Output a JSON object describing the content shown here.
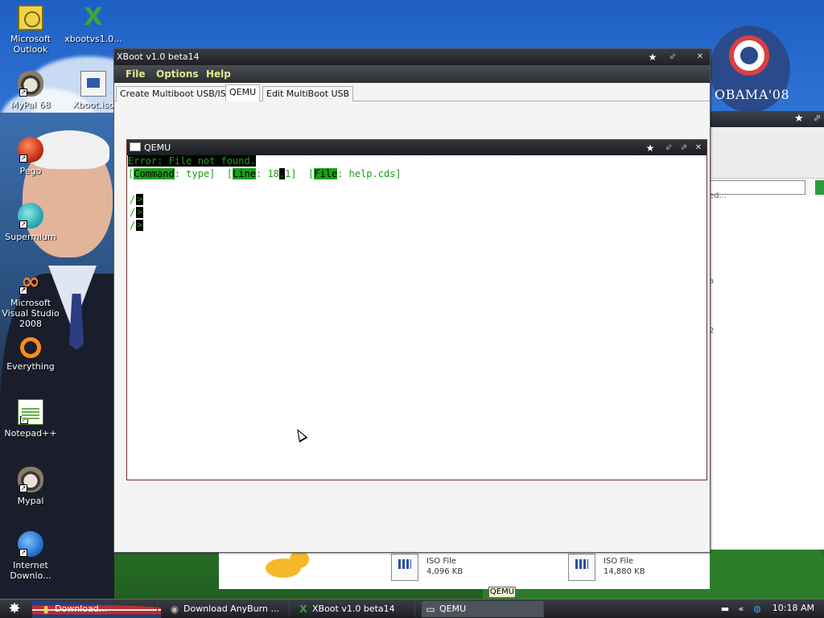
{
  "desktop": {
    "icons": [
      {
        "label": "Microsoft Outlook",
        "icon": "outlook-icon"
      },
      {
        "label": "xbootvs1.0...",
        "icon": "xboot-icon"
      },
      {
        "label": "MyPal 68",
        "icon": "mypal-icon"
      },
      {
        "label": "Xboot.iso",
        "icon": "iso-file-icon"
      },
      {
        "label": "Pego",
        "icon": "pego-icon"
      },
      {
        "label": "Supermium",
        "icon": "supermium-icon"
      },
      {
        "label": "Microsoft Visual Studio 2008",
        "icon": "visual-studio-icon"
      },
      {
        "label": "Everything",
        "icon": "everything-icon"
      },
      {
        "label": "Notepad++",
        "icon": "notepad-plus-plus-icon"
      },
      {
        "label": "Mypal",
        "icon": "mypal-icon"
      },
      {
        "label": "Internet Downlo...",
        "icon": "internet-download-manager-icon"
      }
    ],
    "obama_logo_text": "OBAMA'08"
  },
  "background_window": {
    "fragments": [
      "ed...",
      "a",
      "2"
    ],
    "files": [
      {
        "type": "ISO File",
        "size": "4,096 KB"
      },
      {
        "type": "ISO File",
        "size": "14,880 KB"
      }
    ]
  },
  "xboot": {
    "title": "XBoot v1.0 beta14",
    "menu": [
      "File",
      "Options",
      "Help"
    ],
    "tabs": [
      "Create Multiboot USB/ISO",
      "QEMU",
      "Edit MultiBoot USB"
    ],
    "active_tab": "QEMU"
  },
  "qemu": {
    "title": "QEMU",
    "error_line": "Error: File not found.",
    "status": {
      "command_label": "Command",
      "command_value": "type",
      "line_label": "Line",
      "line_value_a": "18",
      "line_value_b": "1",
      "file_label": "File",
      "file_value": "help.cds"
    }
  },
  "tooltip": "QEMU",
  "taskbar": {
    "tasks": [
      {
        "label": "Download...",
        "icon": "folder-icon"
      },
      {
        "label": "Download AnyBurn ...",
        "icon": "mypal-icon"
      },
      {
        "label": "XBoot v1.0 beta14",
        "icon": "xboot-icon"
      },
      {
        "label": "QEMU",
        "icon": "qemu-icon"
      }
    ],
    "active_task": "QEMU",
    "clock": "10:18 AM"
  },
  "colors": {
    "terminal_green": "#1aa01a",
    "menu_yellow": "#e4e88a",
    "titlebar_dark": "#1f2125"
  }
}
